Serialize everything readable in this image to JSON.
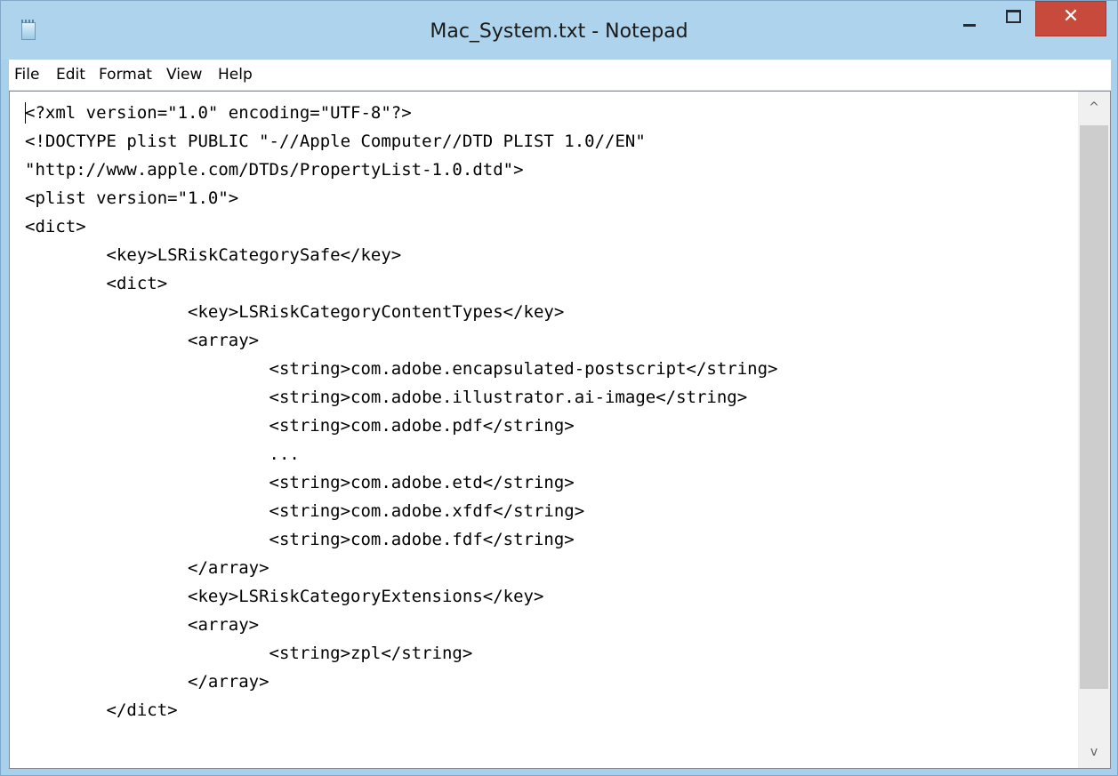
{
  "window": {
    "title": "Mac_System.txt - Notepad",
    "icon": "notepad-icon",
    "controls": {
      "minimize": "minimize-icon",
      "maximize": "maximize-icon",
      "close_glyph": "✕"
    }
  },
  "menubar": {
    "items": [
      "File",
      "Edit",
      "Format",
      "View",
      "Help"
    ]
  },
  "editor": {
    "lines": [
      "<?xml version=\"1.0\" encoding=\"UTF-8\"?>",
      "<!DOCTYPE plist PUBLIC \"-//Apple Computer//DTD PLIST 1.0//EN\"",
      "\"http://www.apple.com/DTDs/PropertyList-1.0.dtd\">",
      "<plist version=\"1.0\">",
      "<dict>",
      "        <key>LSRiskCategorySafe</key>",
      "        <dict>",
      "                <key>LSRiskCategoryContentTypes</key>",
      "                <array>",
      "                        <string>com.adobe.encapsulated-postscript</string>",
      "                        <string>com.adobe.illustrator.ai-image</string>",
      "                        <string>com.adobe.pdf</string>",
      "                        ...",
      "                        <string>com.adobe.etd</string>",
      "                        <string>com.adobe.xfdf</string>",
      "                        <string>com.adobe.fdf</string>",
      "                </array>",
      "                <key>LSRiskCategoryExtensions</key>",
      "                <array>",
      "                        <string>zpl</string>",
      "                </array>",
      "        </dict>"
    ]
  },
  "scrollbar": {
    "up_arrow": "^",
    "down_arrow": "v"
  },
  "colors": {
    "title_bar": "#aed3ec",
    "close_button": "#c74a3d",
    "scroll_thumb": "#cdcdcd"
  }
}
